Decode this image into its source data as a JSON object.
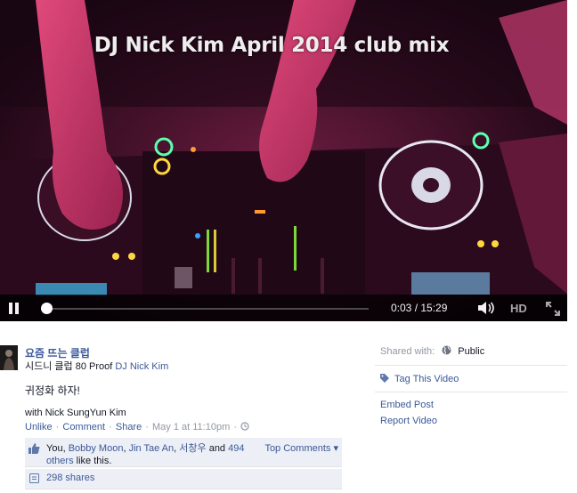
{
  "video": {
    "overlay_title": "DJ Nick Kim April 2014 club mix",
    "time": "0:03 / 15:29",
    "progress": 0.0032,
    "hd_label": "HD",
    "icons": [
      "pause-icon",
      "volume-icon",
      "fullscreen-icon"
    ]
  },
  "story": {
    "page_name": "요즘 뜨는 클럽",
    "place": "시드니 클럽 80 Proof",
    "place_with": "DJ Nick Kim",
    "text": "귀정화 하자!",
    "with_line": "with Nick SungYun Kim",
    "actions": {
      "unlike": "Unlike",
      "comment": "Comment",
      "share": "Share",
      "timestamp": "May 1 at 11:10pm"
    },
    "likes": {
      "prefix": "You, ",
      "person1": "Bobby Moon",
      "person2": "Jin Tae An",
      "person3": "서창우",
      "and": " and ",
      "others_count": "494",
      "others_word": "others",
      "suffix": " like this.",
      "top_comments": "Top Comments ▾"
    },
    "shares": "298 shares"
  },
  "sidebar": {
    "shared_with_label": "Shared with:",
    "audience": "Public",
    "tag_video": "Tag This Video",
    "embed_post": "Embed Post",
    "report_video": "Report Video"
  },
  "colors": {
    "link": "#3b5998",
    "muted": "#9197a3",
    "like_box_bg": "#eceff5"
  }
}
